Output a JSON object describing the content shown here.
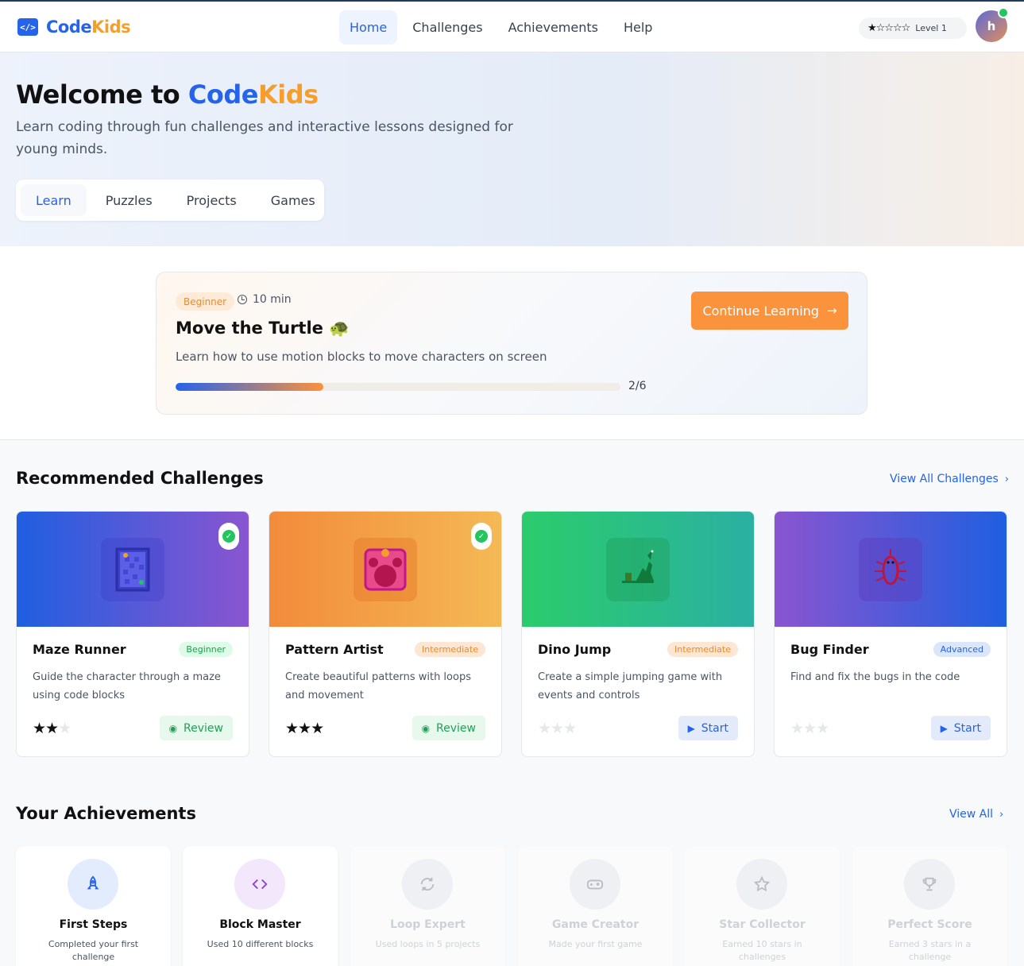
{
  "app": {
    "logo_icon": "</>",
    "brand_part1": "Code",
    "brand_part2": "Kids"
  },
  "nav": [
    {
      "label": "Home",
      "active": true
    },
    {
      "label": "Challenges"
    },
    {
      "label": "Achievements"
    },
    {
      "label": "Help"
    }
  ],
  "user": {
    "stars_display": "★☆☆☆☆",
    "stars_filled": 1,
    "stars_total": 5,
    "level": "Level 1",
    "avatar_initial": "h",
    "online": true
  },
  "hero": {
    "title_prefix": "Welcome to ",
    "title_brand1": "Code",
    "title_brand2": "Kids",
    "subtitle": "Learn coding through fun challenges and interactive lessons designed for young minds.",
    "tabs": [
      {
        "label": "Learn",
        "active": true
      },
      {
        "label": "Puzzles"
      },
      {
        "label": "Projects"
      },
      {
        "label": "Games"
      }
    ]
  },
  "current_lesson": {
    "level": "Beginner",
    "duration": "10 min",
    "title": "Move the Turtle 🐢",
    "description": "Learn how to use motion blocks to move characters on screen",
    "progress_text": "2/6",
    "progress_fraction": 0.333,
    "cta": "Continue Learning",
    "cta_icon": "arrow-right-icon"
  },
  "challenges": {
    "heading": "Recommended Challenges",
    "view_all": "View All Challenges",
    "items": [
      {
        "title": "Maze Runner",
        "level": "Beginner",
        "description": "Guide the character through a maze using code blocks",
        "stars": 2,
        "completed": true,
        "action": "Review",
        "icon": "maze-icon",
        "gradient": [
          "#1f5fe0",
          "#8a55d0"
        ]
      },
      {
        "title": "Pattern Artist",
        "level": "Intermediate",
        "description": "Create beautiful patterns with loops and movement",
        "stars": 3,
        "completed": true,
        "action": "Review",
        "icon": "paint-palette-icon",
        "gradient": [
          "#f28b3b",
          "#f4b955"
        ]
      },
      {
        "title": "Dino Jump",
        "level": "Intermediate",
        "description": "Create a simple jumping game with events and controls",
        "stars": 0,
        "completed": false,
        "action": "Start",
        "icon": "dinosaur-icon",
        "gradient": [
          "#2bcc6c",
          "#2bb0a2"
        ]
      },
      {
        "title": "Bug Finder",
        "level": "Advanced",
        "description": "Find and fix the bugs in the code",
        "stars": 0,
        "completed": false,
        "action": "Start",
        "icon": "bug-icon",
        "gradient": [
          "#8a55d0",
          "#1f5fe0"
        ]
      }
    ]
  },
  "achievements": {
    "heading": "Your Achievements",
    "view_all": "View All",
    "items": [
      {
        "title": "First Steps",
        "description": "Completed your first challenge",
        "unlocked": true,
        "icon": "rocket-icon"
      },
      {
        "title": "Block Master",
        "description": "Used 10 different blocks",
        "unlocked": true,
        "icon": "code-brackets-icon"
      },
      {
        "title": "Loop Expert",
        "description": "Used loops in 5 projects",
        "unlocked": false,
        "icon": "refresh-icon"
      },
      {
        "title": "Game Creator",
        "description": "Made your first game",
        "unlocked": false,
        "icon": "gamepad-icon"
      },
      {
        "title": "Star Collector",
        "description": "Earned 10 stars in challenges",
        "unlocked": false,
        "icon": "star-icon"
      },
      {
        "title": "Perfect Score",
        "description": "Earned 3 stars in a challenge",
        "unlocked": false,
        "icon": "trophy-icon"
      }
    ]
  },
  "colors": {
    "primary": "#2563eb",
    "accent": "#fb923c",
    "success": "#22c55e"
  }
}
